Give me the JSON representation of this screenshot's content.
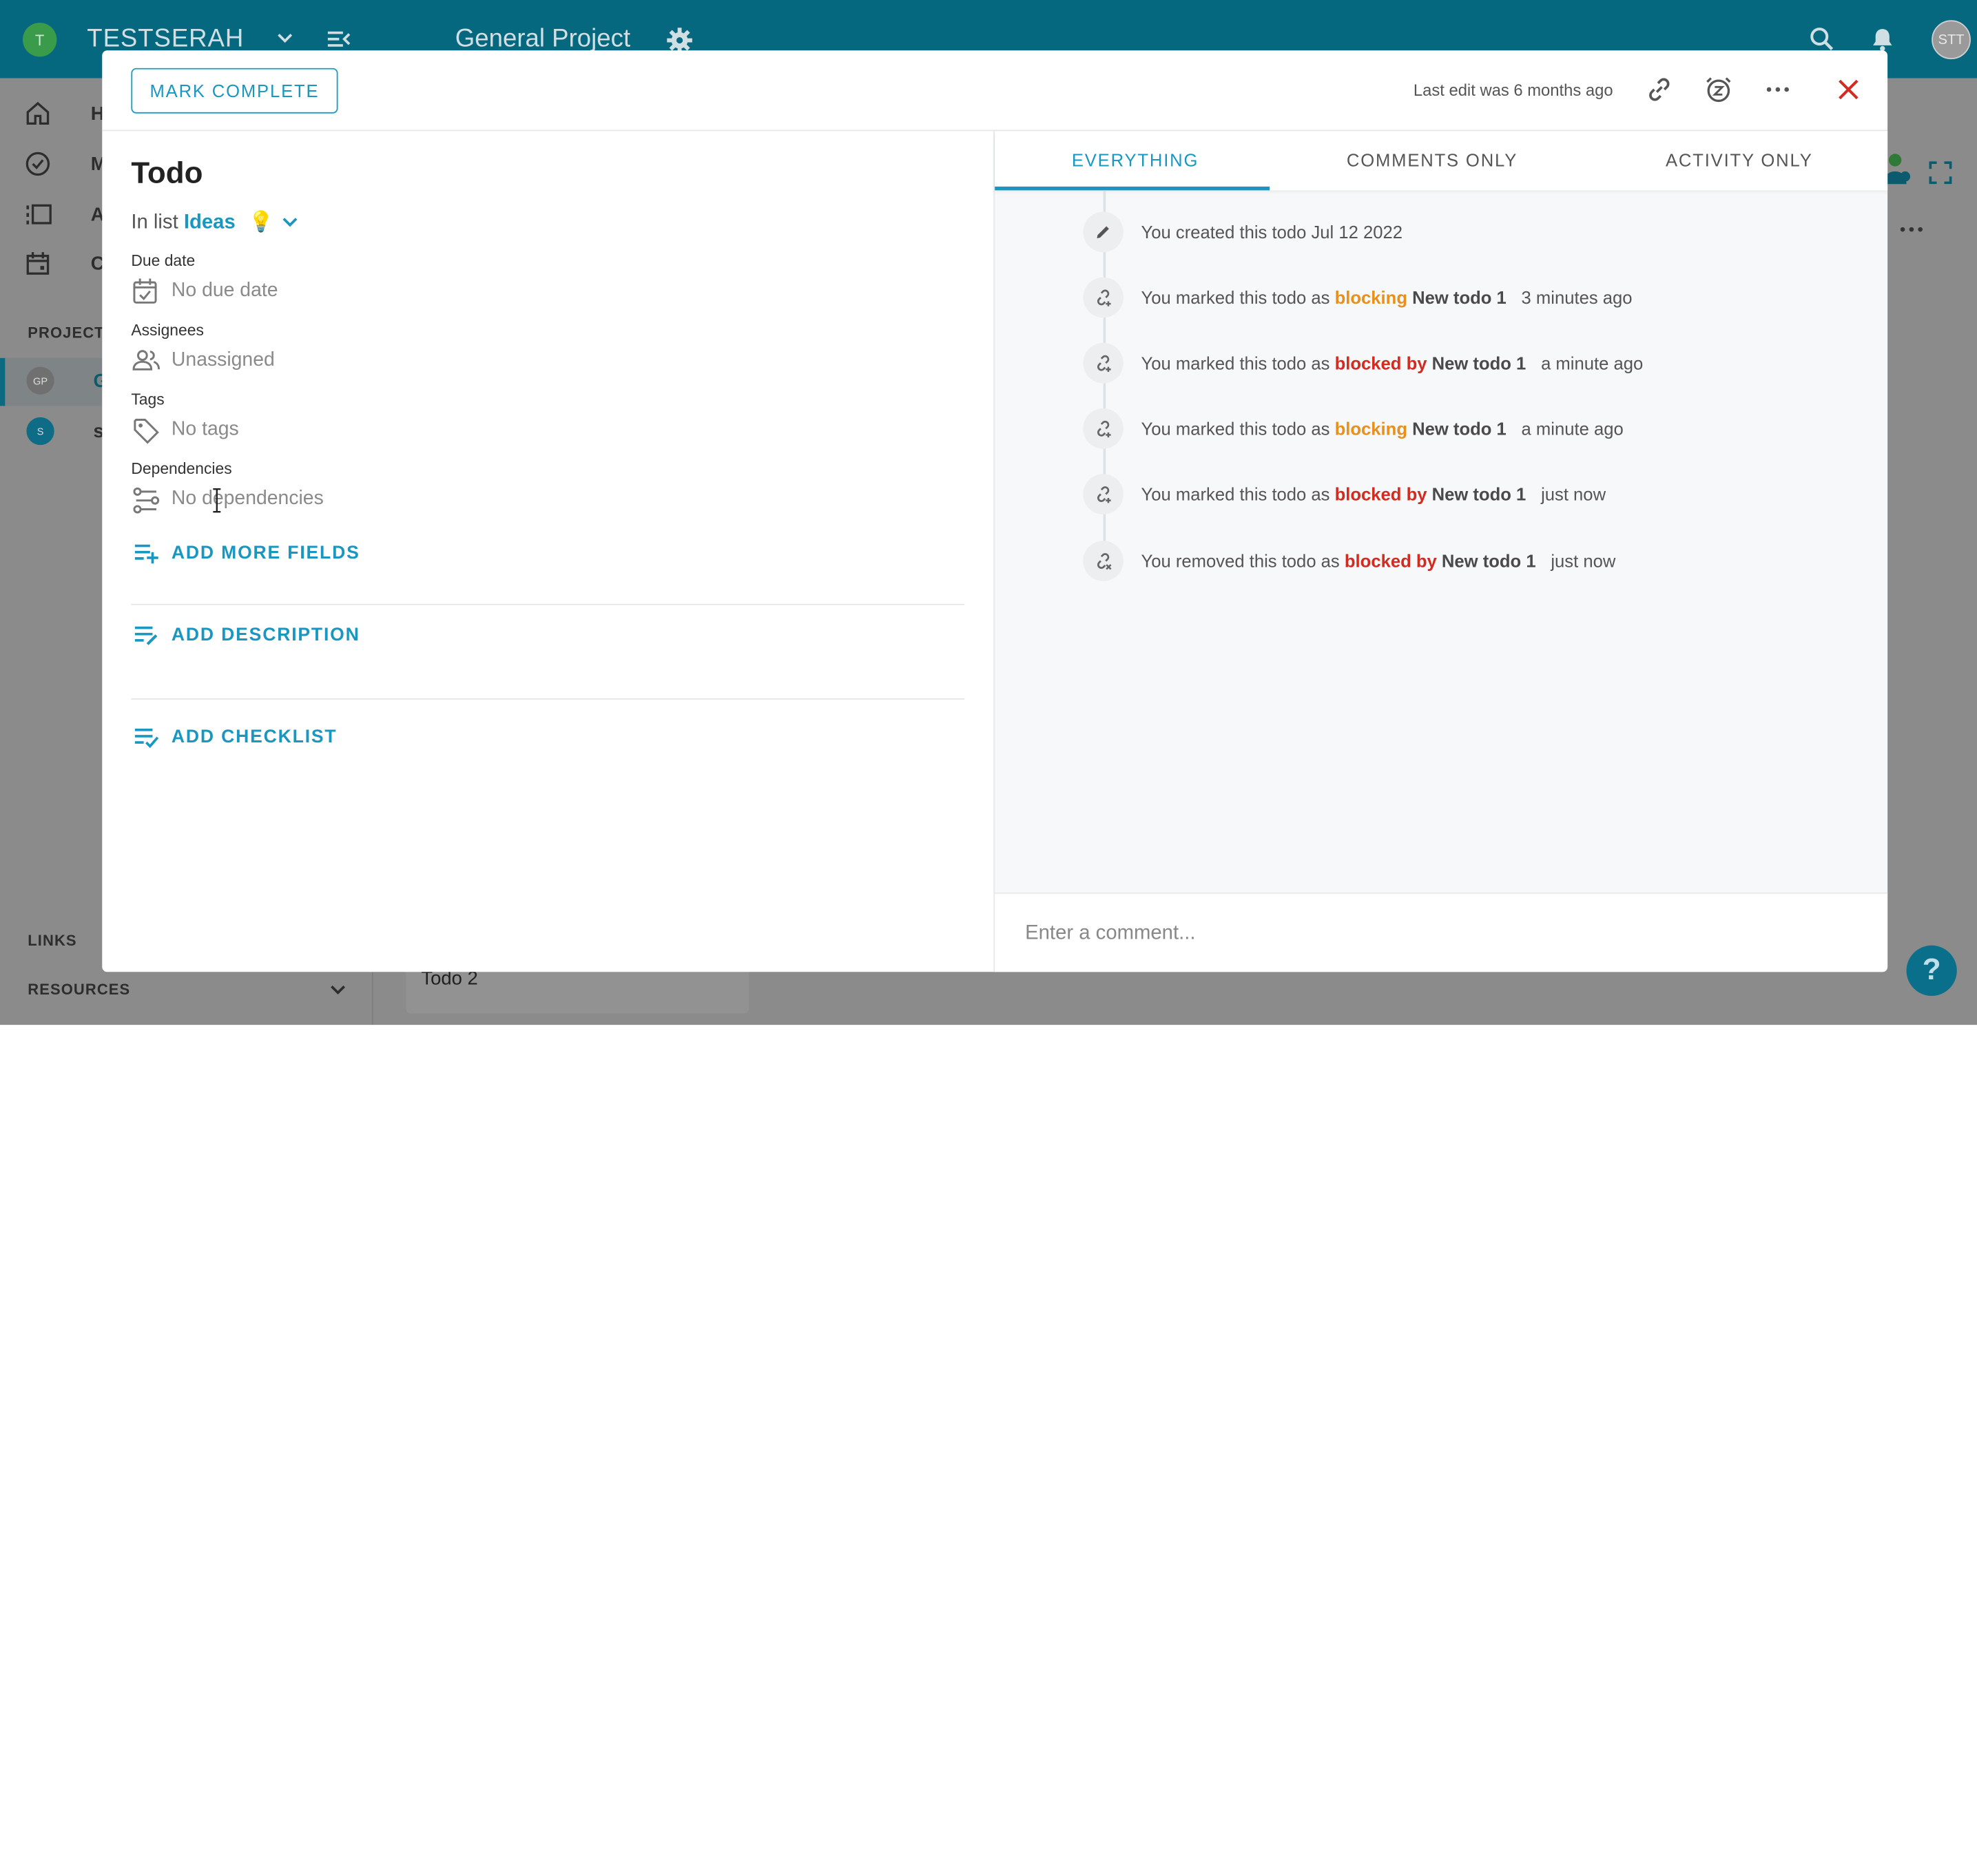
{
  "workspace": {
    "avatar_letter": "T",
    "name": "TESTSERAH"
  },
  "project_header": {
    "title": "General Project"
  },
  "user_avatar": "STT",
  "sidebar": {
    "nav_items": [
      {
        "label": "H",
        "icon": "home-icon"
      },
      {
        "label": "M",
        "icon": "check-circle-icon"
      },
      {
        "label": "A",
        "icon": "activity-icon"
      },
      {
        "label": "C",
        "icon": "calendar-icon"
      }
    ],
    "projects_heading": "PROJECTS",
    "projects": [
      {
        "avatar": "GP",
        "label": "G"
      },
      {
        "avatar": "S",
        "label": "s"
      }
    ],
    "links_heading": "LINKS",
    "resources_heading": "RESOURCES"
  },
  "background_card": {
    "label": "Todo 2"
  },
  "help": {
    "label": "?"
  },
  "modal": {
    "mark_complete": "MARK COMPLETE",
    "last_edit": "Last edit was 6 months ago",
    "title": "Todo",
    "in_list_prefix": "In list",
    "list_name": "Ideas",
    "list_emoji": "💡",
    "fields": {
      "due_date": {
        "label": "Due date",
        "value": "No due date"
      },
      "assignees": {
        "label": "Assignees",
        "value": "Unassigned"
      },
      "tags": {
        "label": "Tags",
        "value": "No tags"
      },
      "dependencies": {
        "label": "Dependencies",
        "value": "No dependencies"
      }
    },
    "actions": {
      "add_more_fields": "ADD MORE FIELDS",
      "add_description": "ADD DESCRIPTION",
      "add_checklist": "ADD CHECKLIST"
    },
    "tabs": [
      {
        "label": "EVERYTHING",
        "active": true
      },
      {
        "label": "COMMENTS ONLY",
        "active": false
      },
      {
        "label": "ACTIVITY ONLY",
        "active": false
      }
    ],
    "activity": [
      {
        "icon": "pencil-icon",
        "text": "You created this todo Jul 12 2022"
      },
      {
        "icon": "link-add-icon",
        "prefix": "You marked this todo as",
        "relation": "blocking",
        "relation_color": "#e8901c",
        "target": "New todo 1",
        "time": "3 minutes ago"
      },
      {
        "icon": "link-add-icon",
        "prefix": "You marked this todo as",
        "relation": "blocked by",
        "relation_color": "#d22b1f",
        "target": "New todo 1",
        "time": "a minute ago"
      },
      {
        "icon": "link-add-icon",
        "prefix": "You marked this todo as",
        "relation": "blocking",
        "relation_color": "#e8901c",
        "target": "New todo 1",
        "time": "a minute ago"
      },
      {
        "icon": "link-add-icon",
        "prefix": "You marked this todo as",
        "relation": "blocked by",
        "relation_color": "#d22b1f",
        "target": "New todo 1",
        "time": "just now"
      },
      {
        "icon": "link-remove-icon",
        "prefix": "You removed this todo as",
        "relation": "blocked by",
        "relation_color": "#d22b1f",
        "target": "New todo 1",
        "time": "just now"
      }
    ],
    "comment_placeholder": "Enter a comment..."
  },
  "colors": {
    "topbar": "#06687e",
    "accent": "#1a97c0",
    "blocking": "#e8901c",
    "blocked_by": "#d22b1f",
    "close": "#d22b1f"
  }
}
